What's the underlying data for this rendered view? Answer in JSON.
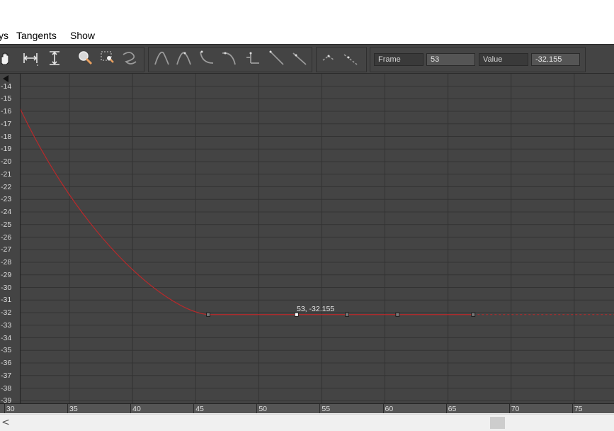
{
  "menu": {
    "items": [
      {
        "label": "ys"
      },
      {
        "label": "Tangents"
      },
      {
        "label": "Show"
      }
    ]
  },
  "toolbar": {
    "frame_label": "Frame",
    "frame_value": "53",
    "value_label": "Value",
    "value_value": "-32.155",
    "icons": {
      "pan": "hand-pan-icon",
      "fit_horizontal": "fit-horizontal-icon",
      "fit_vertical": "fit-vertical-icon",
      "zoom": "zoom-icon",
      "zoom_region": "zoom-region-icon",
      "scale": "scale-values-icon",
      "tan_auto": "tangent-auto-icon",
      "tan_spline": "tangent-spline-icon",
      "tan_fast": "tangent-fast-icon",
      "tan_slow": "tangent-slow-icon",
      "tan_step": "tangent-step-icon",
      "tan_linear": "tangent-linear-icon",
      "tan_smooth": "tangent-smooth-icon",
      "break": "break-tangents-icon",
      "unify": "unify-tangents-icon"
    }
  },
  "graph": {
    "y_labels": [
      "-14",
      "-15",
      "-16",
      "-17",
      "-18",
      "-19",
      "-20",
      "-21",
      "-22",
      "-23",
      "-24",
      "-25",
      "-26",
      "-27",
      "-28",
      "-29",
      "-30",
      "-31",
      "-32",
      "-33",
      "-34",
      "-35",
      "-36",
      "-37",
      "-38",
      "-39"
    ],
    "x_labels": [
      "30",
      "35",
      "40",
      "45",
      "50",
      "55",
      "60",
      "65",
      "70",
      "75"
    ],
    "selected_key_readout": "53, -32.155",
    "curve_color": "#b8292b",
    "keys": [
      {
        "frame": 46,
        "value": -32.155
      },
      {
        "frame": 53,
        "value": -32.155,
        "selected": true
      },
      {
        "frame": 57,
        "value": -32.155
      },
      {
        "frame": 61,
        "value": -32.155
      },
      {
        "frame": 67,
        "value": -32.155
      }
    ]
  },
  "scrollbar": {
    "left_arrow": "<"
  }
}
